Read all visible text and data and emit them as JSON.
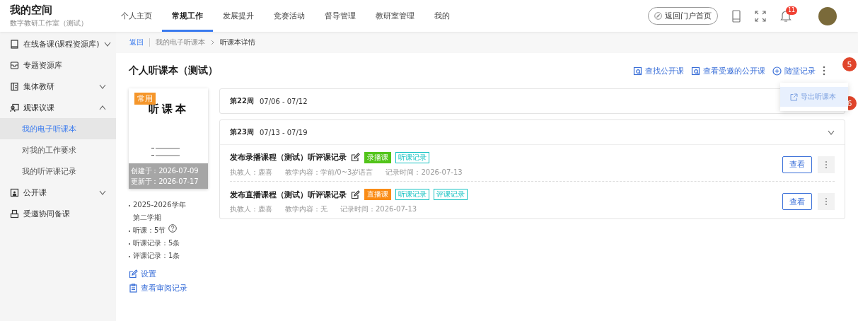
{
  "header": {
    "title": "我的空间",
    "subtitle": "数字教研工作室（测试）",
    "nav": [
      {
        "label": "个人主页",
        "selected": false
      },
      {
        "label": "常规工作",
        "selected": true
      },
      {
        "label": "发展提升",
        "selected": false
      },
      {
        "label": "竞赛活动",
        "selected": false
      },
      {
        "label": "督导管理",
        "selected": false
      },
      {
        "label": "教研室管理",
        "selected": false
      },
      {
        "label": "我的",
        "selected": false
      }
    ],
    "portal_button": "返回门户首页",
    "notification_count": "11"
  },
  "sidebar": {
    "items": [
      {
        "label": "在线备课(课程资源库)",
        "expanded": false
      },
      {
        "label": "专题资源库"
      },
      {
        "label": "集体教研",
        "expanded": false
      },
      {
        "label": "观课议课",
        "expanded": true,
        "children": [
          {
            "label": "我的电子听课本",
            "selected": true
          },
          {
            "label": "对我的工作要求",
            "selected": false
          },
          {
            "label": "我的听评课记录",
            "selected": false
          }
        ]
      },
      {
        "label": "公开课",
        "expanded": false
      },
      {
        "label": "受邀协同备课"
      }
    ]
  },
  "breadcrumb": {
    "back": "返回",
    "items": [
      "我的电子听课本",
      "听课本详情"
    ]
  },
  "page_title": "个人听课本（测试）",
  "actions": [
    "查找公开课",
    "查看受邀的公开课",
    "随堂记录"
  ],
  "marker_more": "5",
  "menu": {
    "items": [
      {
        "label": "导出听课本",
        "selected": true
      }
    ],
    "marker": "6"
  },
  "notebook": {
    "badge": "常用",
    "cover_title": "听课本",
    "created": "创建于：2026-07-09",
    "updated": "更新于：2026-07-17",
    "info": [
      "2025-2026学年第二学期",
      "听课：5节",
      "听课记录：5条",
      "评课记录：1条"
    ],
    "links": [
      "设置",
      "查看审阅记录"
    ]
  },
  "weeks": [
    {
      "week": "第22周",
      "range": "07/06 - 07/12",
      "expanded": false
    },
    {
      "week": "第23周",
      "range": "07/13 - 07/19",
      "expanded": true,
      "records": [
        {
          "title": "发布录播课程（测试）听评课记录",
          "tags": [
            {
              "label": "录播课",
              "kind": "solid",
              "color": "#52c41a"
            },
            {
              "label": "听课记录",
              "kind": "outline",
              "color": "#13c2c2"
            }
          ],
          "teacher": "执教人：鹿喜",
          "content": "教学内容：学前/0~3岁语言",
          "time": "记录时间：2026-07-13",
          "view": "查看"
        },
        {
          "title": "发布直播课程（测试）听评课记录",
          "tags": [
            {
              "label": "直播课",
              "kind": "solid",
              "color": "#fa8c16"
            },
            {
              "label": "听课记录",
              "kind": "outline",
              "color": "#13c2c2"
            },
            {
              "label": "评课记录",
              "kind": "outline",
              "color": "#13c2c2"
            }
          ],
          "teacher": "执教人：鹿喜",
          "content": "教学内容：无",
          "time": "记录时间：2026-07-13",
          "view": "查看"
        }
      ]
    }
  ]
}
